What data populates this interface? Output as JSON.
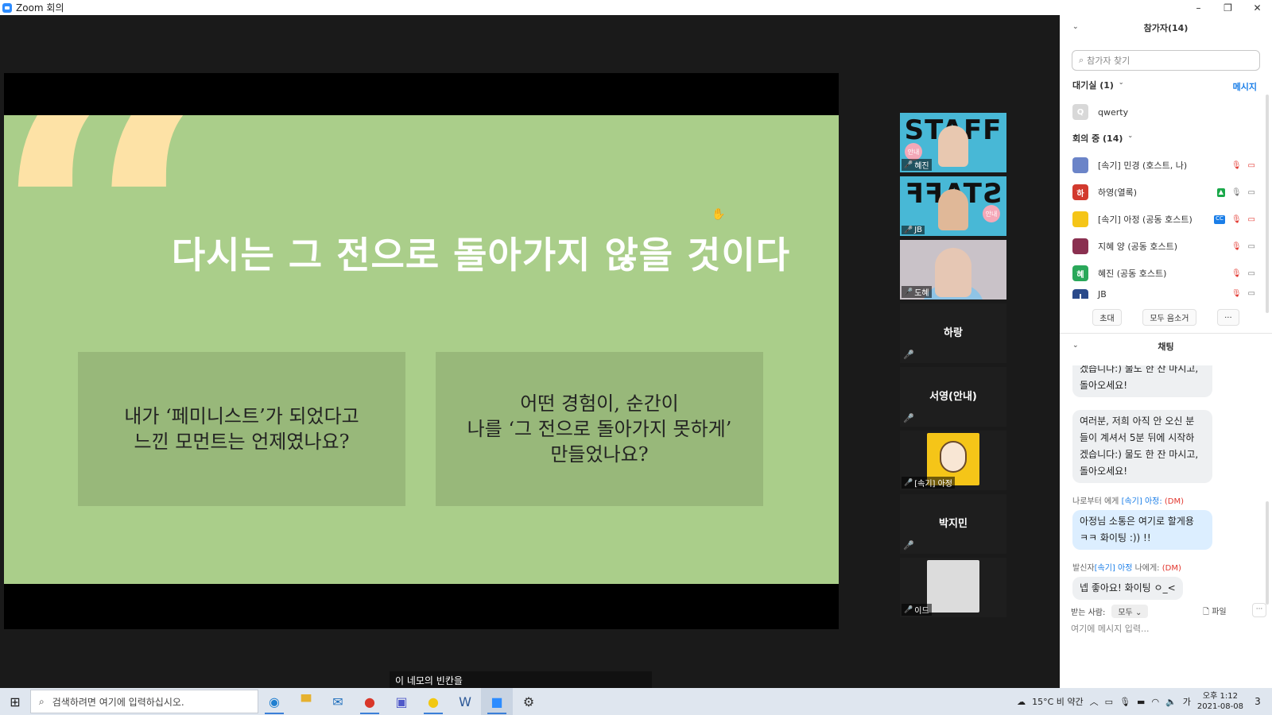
{
  "window": {
    "title": "Zoom 회의"
  },
  "slide": {
    "quote_mark": "“",
    "headline": "다시는 그 전으로 돌아가지 않을 것이다",
    "box_left": "내가 ‘페미니스트’가 되었다고\n느낀 모먼트는 언제였나요?",
    "box_right": "어떤 경험이, 순간이\n나를 ‘그 전으로 돌아가지 못하게’\n만들었나요?"
  },
  "tiles": [
    {
      "name": "혜진",
      "staff": "STAFF",
      "badge": "안내"
    },
    {
      "name": "JB",
      "staff": "STAFF",
      "badge": "안내"
    },
    {
      "name": "도혜"
    },
    {
      "name": "하랑"
    },
    {
      "name": "서영(안내)"
    },
    {
      "name": "[속기] 아정"
    },
    {
      "name": "박지민"
    },
    {
      "name": "이드"
    }
  ],
  "caption": "이 네모의 빈칸을",
  "participants": {
    "header": "참가자(14)",
    "search_placeholder": "참가자 찾기",
    "waiting_label": "대기실 (1)",
    "message_link": "메시지",
    "waiting": [
      {
        "initial": "Q",
        "name": "qwerty"
      }
    ],
    "in_meeting_label": "회의 중 (14)",
    "list": [
      {
        "initial": "",
        "name": "[속기] 민경 (호스트, 나)",
        "color": "#6b84c8"
      },
      {
        "initial": "하",
        "name": "하영(열록)",
        "color": "#d23a2e"
      },
      {
        "initial": "",
        "name": "[속기] 아정 (공동 호스트)",
        "color": "#f5c518"
      },
      {
        "initial": "",
        "name": "지혜 양 (공동 호스트)",
        "color": "#8a3050"
      },
      {
        "initial": "혜",
        "name": "혜진 (공동 호스트)",
        "color": "#2aa85a"
      },
      {
        "initial": "J",
        "name": "JB",
        "color": "#2a4a8a"
      }
    ],
    "invite": "초대",
    "mute_all": "모두 음소거",
    "more": "..."
  },
  "chat": {
    "header": "채팅",
    "messages": [
      {
        "type": "bubble",
        "text": "겠습니다:) 물도 한 잔 마시고,\n돌아오세요!"
      },
      {
        "type": "bubble",
        "text": "여러분, 저희 아직 안 오신 분\n들이 계셔서 5분 뒤에 시작하\n겠습니다:) 물도 한 잔 마시고,\n돌아오세요!"
      },
      {
        "type": "meta",
        "prefix": "나로부터 에게 ",
        "name": "[속기] 아정:",
        "dm": "(DM)"
      },
      {
        "type": "bubble",
        "text": "아정님 소통은 여기로 할게용\nㅋㅋ 화이팅 :)) !!",
        "blue": true
      },
      {
        "type": "meta",
        "prefix": "발신자",
        "name": "[속기] 아정",
        "suffix": " 나에게:",
        "dm": "(DM)"
      },
      {
        "type": "bubble",
        "text": "넵 좋아요! 화이팅 ㅇ_<"
      }
    ],
    "to_label": "받는 사람:",
    "to_value": "모두",
    "file_label": "파일",
    "input_placeholder": "여기에 메시지 입력..."
  },
  "taskbar": {
    "search_placeholder": "검색하려면 여기에 입력하십시오.",
    "weather": "15°C 비 약간",
    "ime": "가",
    "time": "오후 1:12",
    "date": "2021-08-08",
    "notif_count": "3"
  }
}
